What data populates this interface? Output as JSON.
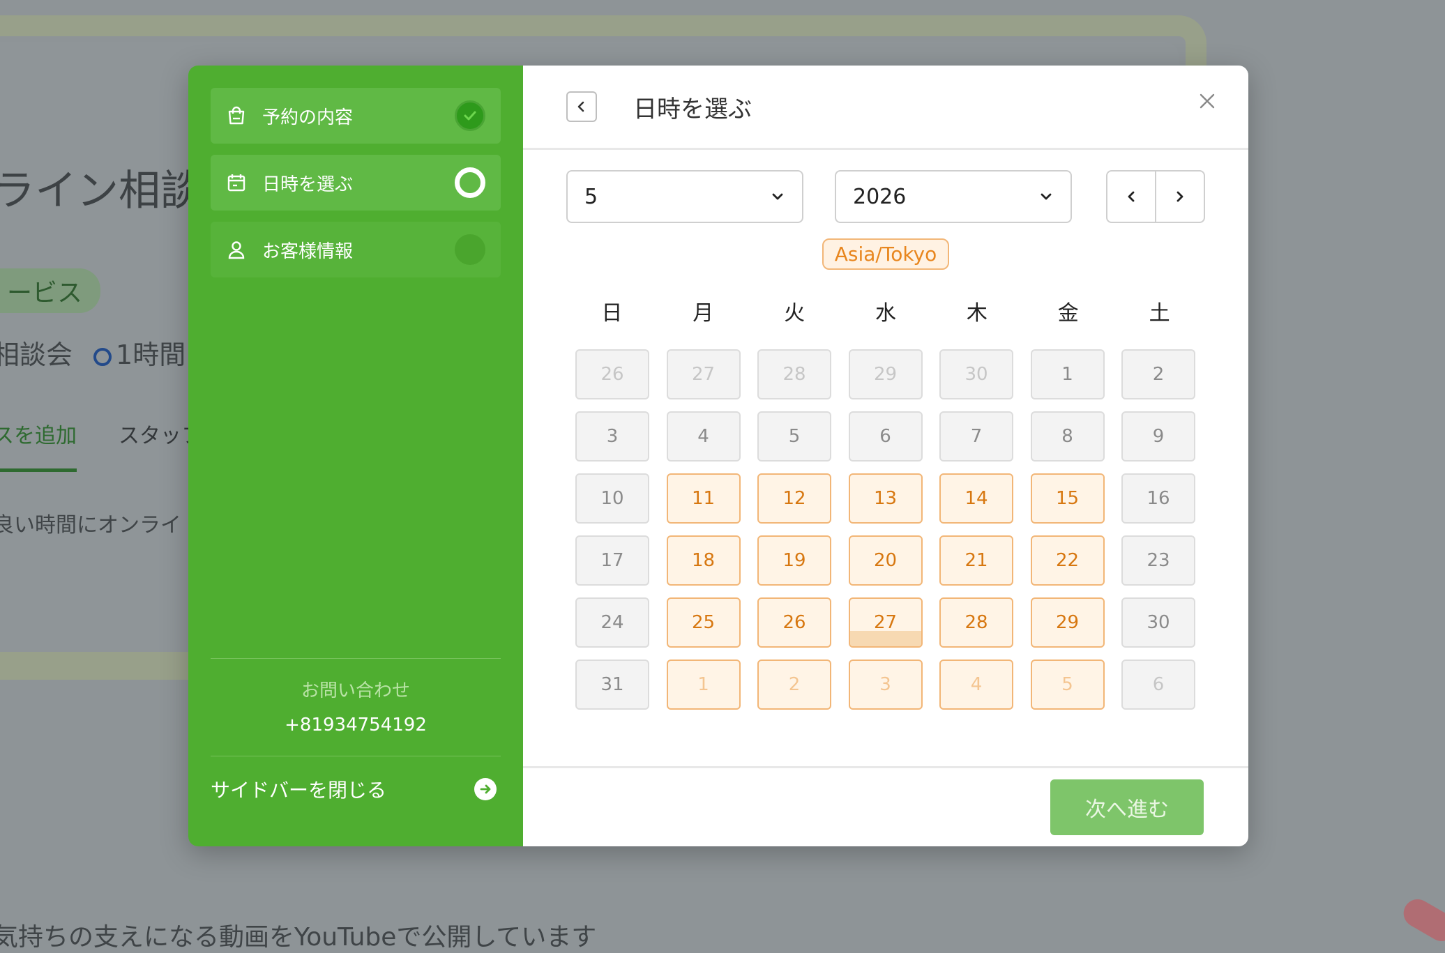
{
  "background": {
    "title": "ライン相談会",
    "tag": "ービス",
    "meta_name": "相談会",
    "meta_duration": "1時間",
    "tab_add": "スを追加",
    "tab_staff": "スタッフ",
    "description": "良い時間にオンライ",
    "bottom_text": "気持ちの支えになる動画をYouTubeで公開しています"
  },
  "sidebar": {
    "steps": [
      {
        "label": "予約の内容",
        "icon": "shopping-bag-icon",
        "status": "done"
      },
      {
        "label": "日時を選ぶ",
        "icon": "calendar-icon",
        "status": "active"
      },
      {
        "label": "お客様情報",
        "icon": "user-icon",
        "status": "todo"
      }
    ],
    "contact_title": "お問い合わせ",
    "contact_phone": "+81934754192",
    "close_label": "サイドバーを閉じる"
  },
  "header": {
    "title": "日時を選ぶ"
  },
  "controls": {
    "month": "5",
    "year": "2026"
  },
  "timezone": "Asia/Tokyo",
  "weekdays": [
    "日",
    "月",
    "火",
    "水",
    "木",
    "金",
    "土"
  ],
  "days": [
    {
      "n": "26",
      "available": false,
      "outside": true
    },
    {
      "n": "27",
      "available": false,
      "outside": true
    },
    {
      "n": "28",
      "available": false,
      "outside": true
    },
    {
      "n": "29",
      "available": false,
      "outside": true
    },
    {
      "n": "30",
      "available": false,
      "outside": true
    },
    {
      "n": "1",
      "available": false,
      "outside": false
    },
    {
      "n": "2",
      "available": false,
      "outside": false
    },
    {
      "n": "3",
      "available": false,
      "outside": false
    },
    {
      "n": "4",
      "available": false,
      "outside": false
    },
    {
      "n": "5",
      "available": false,
      "outside": false
    },
    {
      "n": "6",
      "available": false,
      "outside": false
    },
    {
      "n": "7",
      "available": false,
      "outside": false
    },
    {
      "n": "8",
      "available": false,
      "outside": false
    },
    {
      "n": "9",
      "available": false,
      "outside": false
    },
    {
      "n": "10",
      "available": false,
      "outside": false
    },
    {
      "n": "11",
      "available": true,
      "outside": false
    },
    {
      "n": "12",
      "available": true,
      "outside": false
    },
    {
      "n": "13",
      "available": true,
      "outside": false
    },
    {
      "n": "14",
      "available": true,
      "outside": false
    },
    {
      "n": "15",
      "available": true,
      "outside": false
    },
    {
      "n": "16",
      "available": false,
      "outside": false
    },
    {
      "n": "17",
      "available": false,
      "outside": false
    },
    {
      "n": "18",
      "available": true,
      "outside": false
    },
    {
      "n": "19",
      "available": true,
      "outside": false
    },
    {
      "n": "20",
      "available": true,
      "outside": false
    },
    {
      "n": "21",
      "available": true,
      "outside": false
    },
    {
      "n": "22",
      "available": true,
      "outside": false
    },
    {
      "n": "23",
      "available": false,
      "outside": false
    },
    {
      "n": "24",
      "available": false,
      "outside": false
    },
    {
      "n": "25",
      "available": true,
      "outside": false
    },
    {
      "n": "26",
      "available": true,
      "outside": false
    },
    {
      "n": "27",
      "available": true,
      "outside": false,
      "today": true
    },
    {
      "n": "28",
      "available": true,
      "outside": false
    },
    {
      "n": "29",
      "available": true,
      "outside": false
    },
    {
      "n": "30",
      "available": false,
      "outside": false
    },
    {
      "n": "31",
      "available": false,
      "outside": false
    },
    {
      "n": "1",
      "available": true,
      "outside": true
    },
    {
      "n": "2",
      "available": true,
      "outside": true
    },
    {
      "n": "3",
      "available": true,
      "outside": true
    },
    {
      "n": "4",
      "available": true,
      "outside": true
    },
    {
      "n": "5",
      "available": true,
      "outside": true
    },
    {
      "n": "6",
      "available": false,
      "outside": true
    }
  ],
  "footer": {
    "next_label": "次へ進む"
  },
  "colors": {
    "sidebar": "#4fae30",
    "accent_orange": "#e8861e",
    "next_button": "#7ec56a"
  }
}
